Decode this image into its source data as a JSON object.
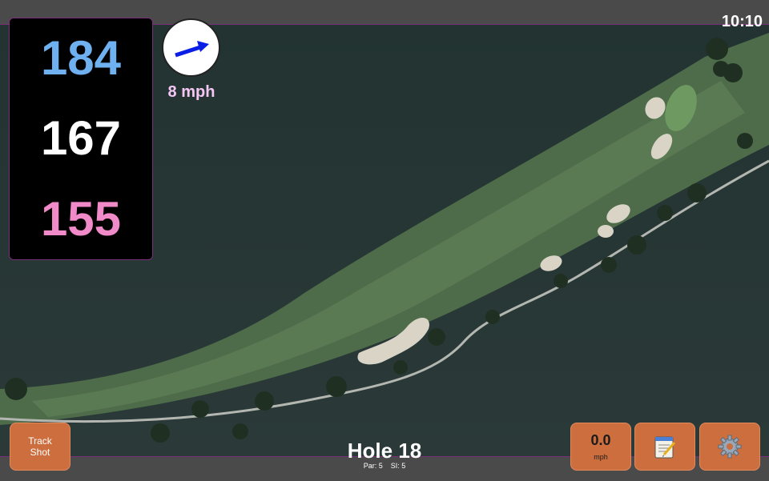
{
  "status": {
    "time": "10:10"
  },
  "distances": {
    "back": {
      "value": "184",
      "color": "#6fb1f0"
    },
    "middle": {
      "value": "167",
      "color": "#ffffff"
    },
    "front": {
      "value": "155",
      "color": "#f08ac8"
    }
  },
  "wind": {
    "speed": "8 mph",
    "arrow_color": "#0a1ee6"
  },
  "hole": {
    "title": "Hole 18",
    "par": "Par: 5",
    "si": "SI: 5"
  },
  "buttons": {
    "track_shot": {
      "line1": "Track",
      "line2": "Shot"
    },
    "speed": {
      "value": "0.0",
      "unit": "mph"
    },
    "notes_icon": "notepad-icon",
    "settings_icon": "gear-icon"
  },
  "colors": {
    "accent": "#cc6e3e",
    "border": "#7a2f7a"
  }
}
